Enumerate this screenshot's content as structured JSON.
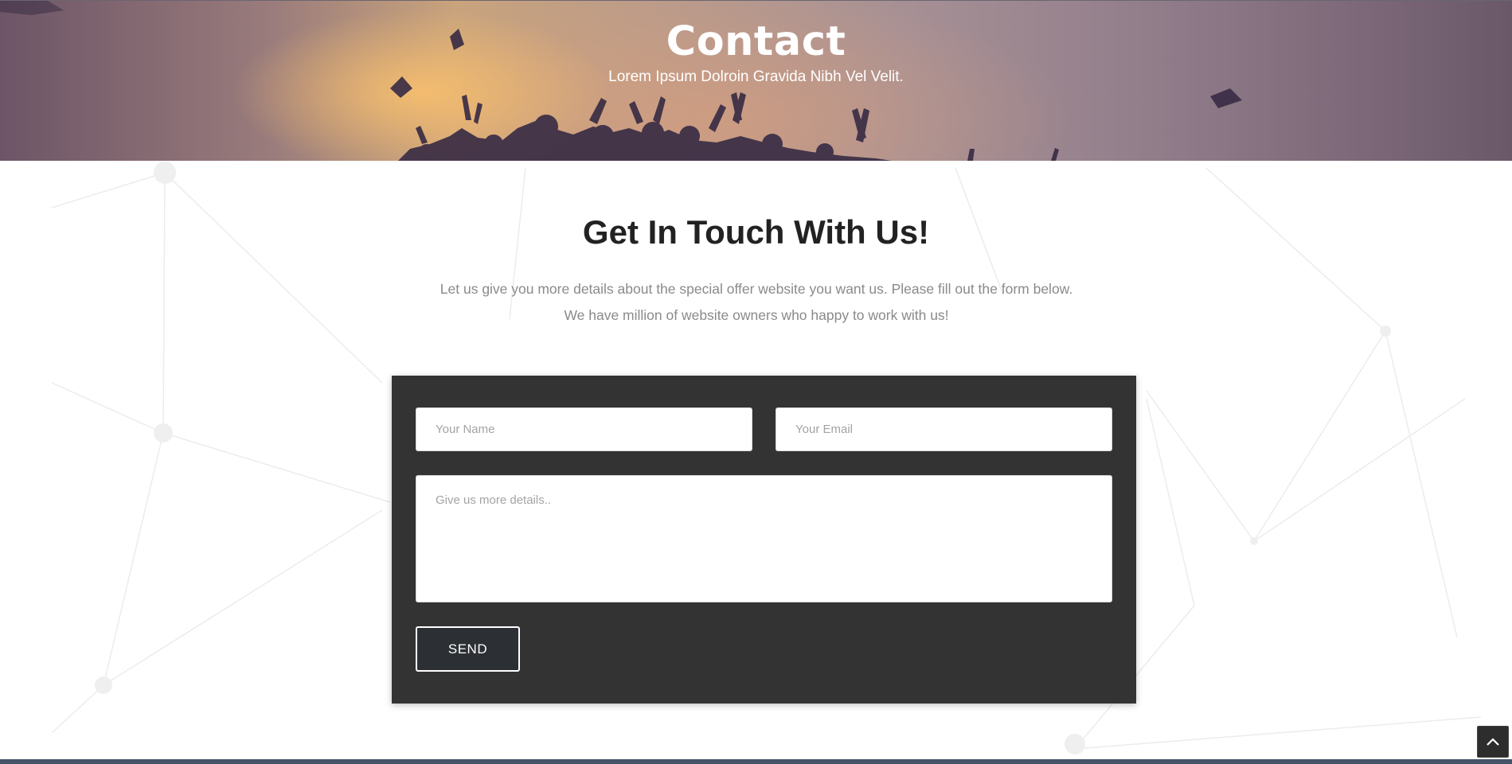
{
  "hero": {
    "title": "Contact",
    "subtitle": "Lorem Ipsum Dolroin Gravida Nibh Vel Velit."
  },
  "intro": {
    "title": "Get In Touch With Us!",
    "line1": "Let us give you more details about the special offer website you want us. Please fill out the form below.",
    "line2": "We have million of website owners who happy to work with us!"
  },
  "form": {
    "name_placeholder": "Your Name",
    "email_placeholder": "Your Email",
    "details_placeholder": "Give us more details..",
    "send_label": "SEND"
  },
  "scroll_top": {
    "icon": "chevron-up-icon"
  },
  "colors": {
    "form_background": "#333333",
    "button_background": "#2c2f33",
    "footer_strip": "#465266",
    "heading": "#222222",
    "body_text": "#8a8a8a"
  }
}
